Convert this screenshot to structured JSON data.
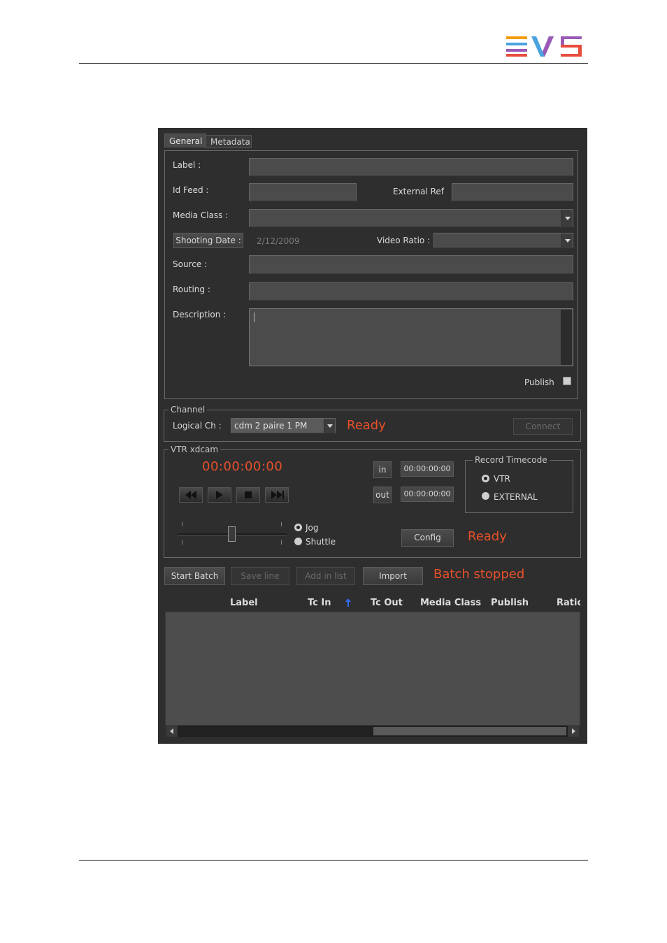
{
  "logo": {
    "text": "EVS",
    "colors": [
      "#f39c12",
      "#4aa3df",
      "#9b59b6",
      "#e74c3c"
    ]
  },
  "tabs": [
    {
      "label": "General",
      "active": true
    },
    {
      "label": "Metadata",
      "active": false
    }
  ],
  "general": {
    "label_label": "Label :",
    "idfeed_label": "Id Feed :",
    "external_ref_label": "External Ref",
    "media_class_label": "Media Class :",
    "shooting_date_button": "Shooting Date :",
    "shooting_date_value": "2/12/2009",
    "video_ratio_label": "Video Ratio :",
    "source_label": "Source :",
    "routing_label": "Routing :",
    "description_label": "Description :",
    "publish_label": "Publish",
    "publish_checked": false
  },
  "channel": {
    "legend": "Channel",
    "logical_ch_label": "Logical Ch :",
    "logical_ch_value": "cdm 2 paire 1 PM",
    "status": "Ready",
    "connect_button": "Connect"
  },
  "vtr": {
    "legend": "VTR xdcam",
    "timecode": "00:00:00:00",
    "in_button": "in",
    "in_value": "00:00:00:00",
    "out_button": "out",
    "out_value": "00:00:00:00",
    "record_timecode_legend": "Record Timecode",
    "record_options": [
      {
        "label": "VTR",
        "selected": true
      },
      {
        "label": "EXTERNAL",
        "selected": false
      }
    ],
    "mode_options": [
      {
        "label": "Jog",
        "selected": true
      },
      {
        "label": "Shuttle",
        "selected": false
      }
    ],
    "slider_level": 0.5,
    "config_button": "Config",
    "status": "Ready"
  },
  "batch": {
    "start_batch": "Start Batch",
    "save_line": "Save line",
    "add_in_list": "Add in list",
    "import": "Import",
    "status": "Batch stopped"
  },
  "table": {
    "columns": [
      "Label",
      "Tc In",
      "Tc Out",
      "Media Class",
      "Publish",
      "Ratio"
    ],
    "sort_column": "Tc In",
    "rows": []
  },
  "accent_color": "#e8502a"
}
